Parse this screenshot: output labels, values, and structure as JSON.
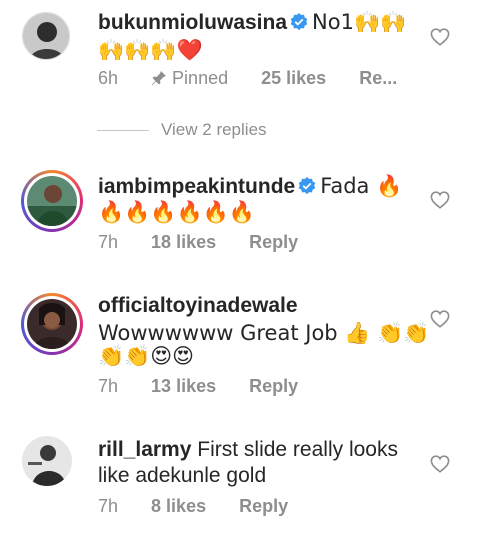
{
  "comments": [
    {
      "username": "bukunmioluwasina",
      "line1": "No1🙌🙌",
      "line2": "🙌🙌🙌❤️",
      "time": "6h",
      "pinned": "Pinned",
      "likes": "25 likes",
      "reply": "Re..."
    },
    {
      "username": "iambimpeakintunde",
      "line1": "Fada 🔥",
      "line2": "🔥🔥🔥🔥🔥🔥",
      "time": "7h",
      "likes": "18 likes",
      "reply": "Reply"
    },
    {
      "username": "officialtoyinadewale",
      "line1": "Wowwwwww Great Job 👍 👏👏",
      "line2": "👏👏😍😍",
      "time": "7h",
      "likes": "13 likes",
      "reply": "Reply"
    },
    {
      "username": "rill_larmy",
      "line1": "First slide really looks",
      "line2": "like adekunle gold",
      "time": "7h",
      "likes": "8 likes",
      "reply": "Reply"
    }
  ],
  "view_replies": "View 2 replies",
  "colors": {
    "text": "#262626",
    "meta": "#8e8e8e",
    "verified": "#3897f0",
    "heart_outline": "#8e8e8e"
  },
  "icons": {
    "verified": "verified-badge-icon",
    "pin": "pin-icon",
    "like": "heart-outline-icon"
  }
}
